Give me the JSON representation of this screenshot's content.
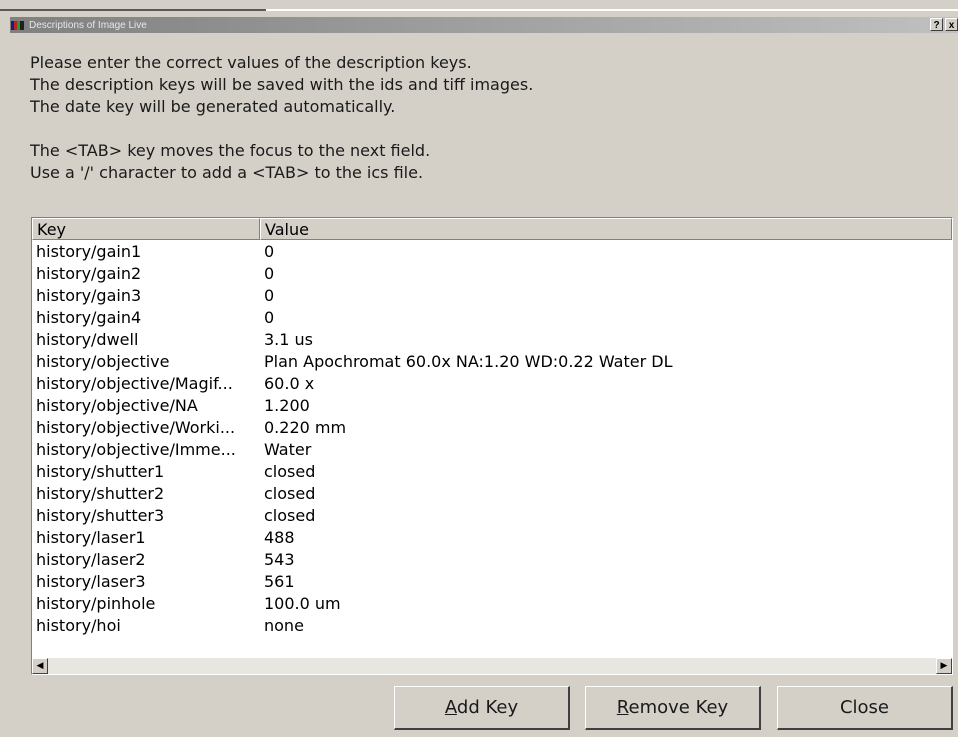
{
  "window": {
    "title": "Descriptions of Image Live",
    "help_button": "?",
    "close_button": "x"
  },
  "instructions": [
    "Please enter the correct values of the description keys.",
    "The description keys will be saved with the ids and tiff images.",
    "The date key will be generated automatically.",
    "",
    "The <TAB> key moves the focus to the next field.",
    "Use a '/' character to add a <TAB> to the ics file."
  ],
  "table": {
    "columns": {
      "key": "Key",
      "value": "Value"
    },
    "rows": [
      {
        "key": "history/gain1",
        "value": "0"
      },
      {
        "key": "history/gain2",
        "value": "0"
      },
      {
        "key": "history/gain3",
        "value": "0"
      },
      {
        "key": "history/gain4",
        "value": "0"
      },
      {
        "key": "history/dwell",
        "value": "3.1 us"
      },
      {
        "key": "history/objective",
        "value": "Plan Apochromat  60.0x NA:1.20 WD:0.22 Water DL"
      },
      {
        "key": "history/objective/Magif...",
        "value": "60.0 x"
      },
      {
        "key": "history/objective/NA",
        "value": "1.200"
      },
      {
        "key": "history/objective/Worki...",
        "value": "0.220 mm"
      },
      {
        "key": "history/objective/Imme...",
        "value": "Water"
      },
      {
        "key": "history/shutter1",
        "value": "closed"
      },
      {
        "key": "history/shutter2",
        "value": "closed"
      },
      {
        "key": "history/shutter3",
        "value": "closed"
      },
      {
        "key": "history/laser1",
        "value": "488"
      },
      {
        "key": "history/laser2",
        "value": "543"
      },
      {
        "key": "history/laser3",
        "value": "561"
      },
      {
        "key": "history/pinhole",
        "value": "100.0 um"
      },
      {
        "key": "history/hoi",
        "value": "none"
      }
    ]
  },
  "buttons": {
    "add_key": {
      "mnemonic": "A",
      "rest": "dd Key"
    },
    "remove_key": {
      "mnemonic": "R",
      "rest": "emove Key"
    },
    "close": "Close"
  }
}
